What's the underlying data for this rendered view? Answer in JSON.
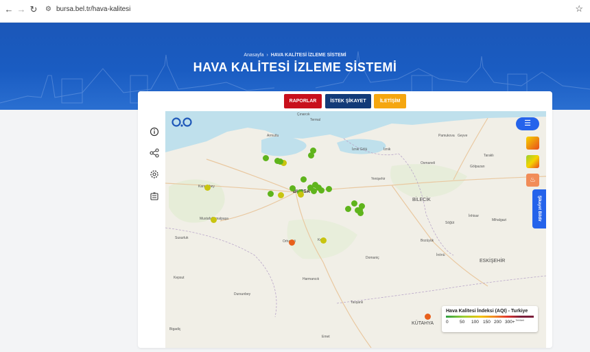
{
  "browser": {
    "url": "bursa.bel.tr/hava-kalitesi"
  },
  "hero": {
    "breadcrumb_home": "Anasayfa",
    "breadcrumb_sep": "›",
    "breadcrumb_current": "HAVA KALİTESİ İZLEME SİSTEMİ",
    "title": "HAVA KALİTESİ İZLEME SİSTEMİ"
  },
  "actions": {
    "reports": "RAPORLAR",
    "request": "İSTEK ŞİKAYET",
    "contact": "İLETİŞİM"
  },
  "colors": {
    "reports": "#c8101c",
    "request": "#123a78",
    "contact": "#f5a60f",
    "good": "#5fb41c",
    "moderate": "#c8c410",
    "unhealthy": "#e8601c"
  },
  "map": {
    "report_label": "Şikayet Bildir",
    "places": [
      {
        "name": "Çınarcık"
      },
      {
        "name": "Termal"
      },
      {
        "name": "Armutlu"
      },
      {
        "name": "İznik Gölü"
      },
      {
        "name": "İznik"
      },
      {
        "name": "Pamukova"
      },
      {
        "name": "Geyve"
      },
      {
        "name": "Osmaneli"
      },
      {
        "name": "Taraklı"
      },
      {
        "name": "Gölpazarı"
      },
      {
        "name": "Yenişehir"
      },
      {
        "name": "Karacabey"
      },
      {
        "name": "BURSA"
      },
      {
        "name": "BİLECİK"
      },
      {
        "name": "Mustafakemalpaşa"
      },
      {
        "name": "İnhisar"
      },
      {
        "name": "Söğüt"
      },
      {
        "name": "Mihalgazi"
      },
      {
        "name": "Susurluk"
      },
      {
        "name": "Orhaneli"
      },
      {
        "name": "Keles"
      },
      {
        "name": "Bozüyük"
      },
      {
        "name": "İnönü"
      },
      {
        "name": "Domaniç"
      },
      {
        "name": "ESKİŞEHİR"
      },
      {
        "name": "Kepsut"
      },
      {
        "name": "Harmancık"
      },
      {
        "name": "Dursunbey"
      },
      {
        "name": "Tavşanlı"
      },
      {
        "name": "KÜTAHYA"
      },
      {
        "name": "Bigadiç"
      },
      {
        "name": "Emet"
      }
    ],
    "stations": [
      {
        "level": "good"
      },
      {
        "level": "good"
      },
      {
        "level": "good"
      },
      {
        "level": "good"
      },
      {
        "level": "moderate"
      },
      {
        "level": "good"
      },
      {
        "level": "good"
      },
      {
        "level": "good"
      },
      {
        "level": "good"
      },
      {
        "level": "good"
      },
      {
        "level": "good"
      },
      {
        "level": "good"
      },
      {
        "level": "good"
      },
      {
        "level": "moderate"
      },
      {
        "level": "good"
      },
      {
        "level": "good"
      },
      {
        "level": "good"
      },
      {
        "level": "good"
      },
      {
        "level": "good"
      },
      {
        "level": "good"
      },
      {
        "level": "good"
      },
      {
        "level": "good"
      },
      {
        "level": "good"
      },
      {
        "level": "moderate"
      },
      {
        "level": "moderate"
      },
      {
        "level": "moderate"
      },
      {
        "level": "moderate"
      },
      {
        "level": "unhealthy"
      }
    ]
  },
  "legend": {
    "title": "Hava Kalitesi İndeksi (AQI) - Turkiye",
    "ticks": [
      "0",
      "50",
      "100",
      "150",
      "200",
      "300+"
    ],
    "tag": "Tehlikeli"
  }
}
